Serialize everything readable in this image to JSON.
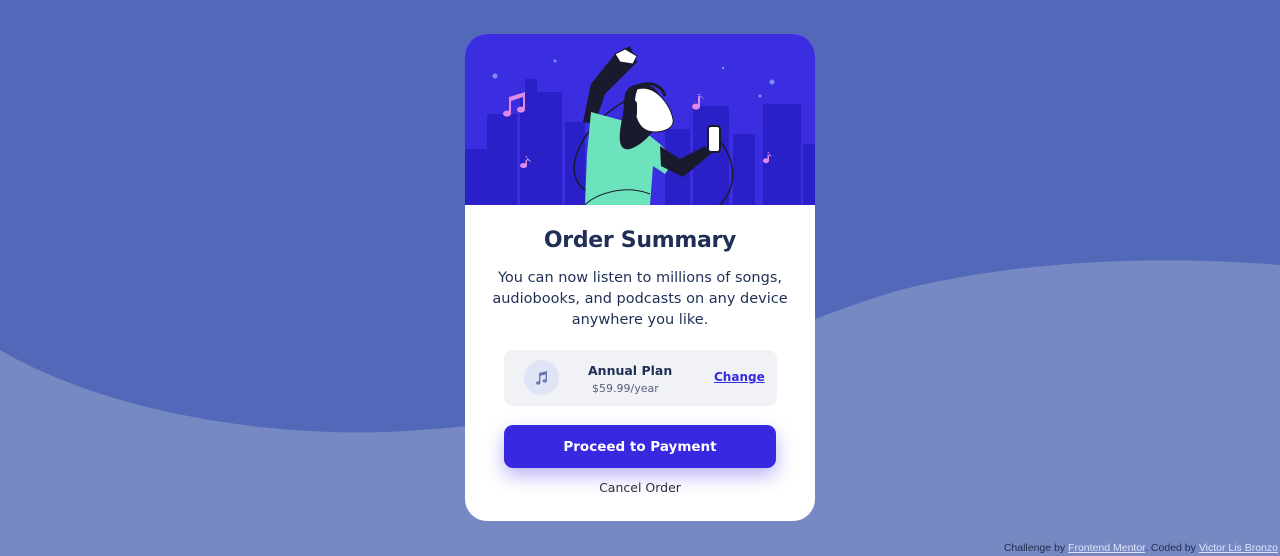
{
  "colors": {
    "background": "#5368b8",
    "wave": "#7689c2",
    "hero": "#3b2de0",
    "accent": "#3828e0",
    "title": "#1f2f56"
  },
  "card": {
    "title": "Order Summary",
    "description": "You can now listen to millions of songs, audiobooks, and podcasts on any device anywhere you like.",
    "hero_icon": "person-dancing-with-headphones-illustration"
  },
  "plan": {
    "icon": "music-note-icon",
    "name": "Annual Plan",
    "price": "$59.99/year",
    "change_label": "Change"
  },
  "actions": {
    "proceed_label": "Proceed to Payment",
    "cancel_label": "Cancel Order"
  },
  "attribution": {
    "prefix": "Challenge by",
    "frontend_mentor": "Frontend Mentor",
    "coded_by": ". Coded by",
    "author": "Victor Lis Bronzo"
  }
}
